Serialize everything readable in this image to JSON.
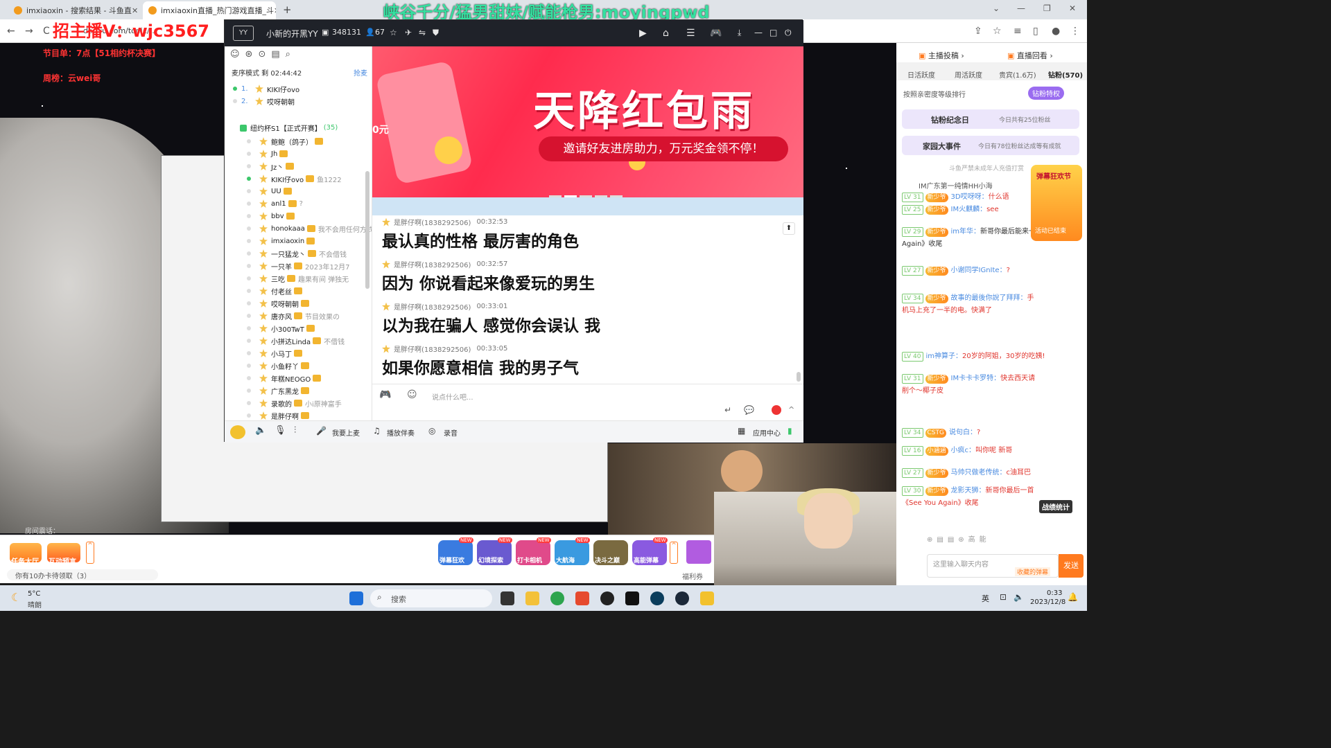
{
  "browser": {
    "tabs": [
      {
        "title": "imxiaoxin - 搜索结果 - 斗鱼直"
      },
      {
        "title": "imxiaoxin直播_热门游戏直播_斗"
      }
    ],
    "url": "douyu.com/topic/..."
  },
  "overlay": {
    "top_banner": "峡谷千分/猛男甜妹/赋能枪男:moyingpwd",
    "red_banner": "招主播V：wjc3567",
    "schedule": "节目单：7点【51相约杯决赛】",
    "weekly": "周榜：云wei哥"
  },
  "yy": {
    "title": "小新的开黑YY",
    "channel_id": "348131",
    "online_count": "67",
    "mode_label": "麦序模式 剩 02:44:42",
    "grab_mic": "抢麦",
    "queue": [
      {
        "rank": "1.",
        "name": "KIKI仔ovo"
      },
      {
        "rank": "2.",
        "name": "哎呀朝朝"
      }
    ],
    "group_title": "纽约杯S1【正式开赛】",
    "group_count": "(35)",
    "members": [
      {
        "name": "鲍鲍（鸽子）",
        "note": ""
      },
      {
        "name": "Jh",
        "note": ""
      },
      {
        "name": "Jz丶",
        "note": ""
      },
      {
        "name": "KIKI仔ovo",
        "note": "鱼1222"
      },
      {
        "name": "UU",
        "note": ""
      },
      {
        "name": "anl1",
        "note": "?"
      },
      {
        "name": "bbv",
        "note": ""
      },
      {
        "name": "honokaaa",
        "note": "我不会用任何方式"
      },
      {
        "name": "imxiaoxin",
        "note": ""
      },
      {
        "name": "一只猛龙丶",
        "note": "不会借钱"
      },
      {
        "name": "一只羊",
        "note": "2023年12月7"
      },
      {
        "name": "三吃",
        "note": "趣果有间 弹独无"
      },
      {
        "name": "付老丝",
        "note": ""
      },
      {
        "name": "哎呀朝朝",
        "note": ""
      },
      {
        "name": "唐亦风",
        "note": "节目效果の"
      },
      {
        "name": "小300TwT",
        "note": ""
      },
      {
        "name": "小拼达Linda",
        "note": "不借钱"
      },
      {
        "name": "小马丁",
        "note": ""
      },
      {
        "name": "小鱼籽丫",
        "note": ""
      },
      {
        "name": "年糕NEOGO",
        "note": ""
      },
      {
        "name": "广东黑龙",
        "note": ""
      },
      {
        "name": "录歌的",
        "note": "小i原神富手"
      },
      {
        "name": "是胖仔啊",
        "note": ""
      }
    ],
    "banner": {
      "title": "天降红包雨",
      "subtitle": "邀请好友进房助力，万元奖金领不停！",
      "coupon": "0元"
    },
    "messages": [
      {
        "sender": "是胖仔啊(1838292506)",
        "time": "00:32:53",
        "text": "最认真的性格 最厉害的角色"
      },
      {
        "sender": "是胖仔啊(1838292506)",
        "time": "00:32:57",
        "text": "因为 你说看起来像爱玩的男生"
      },
      {
        "sender": "是胖仔啊(1838292506)",
        "time": "00:33:01",
        "text": "以为我在骗人 感觉你会误认 我"
      },
      {
        "sender": "是胖仔啊(1838292506)",
        "time": "00:33:05",
        "text": "如果你愿意相信 我的男子气"
      }
    ],
    "input_placeholder": "说点什么吧...",
    "bottom": {
      "mic_up": "我要上麦",
      "play_music": "播放伴奏",
      "record": "录音",
      "app_center": "应用中心"
    }
  },
  "right_panel": {
    "top_links": [
      "主播投稿",
      "直播回看"
    ],
    "rank_tabs": [
      "日活跃度",
      "周活跃度",
      "贵宾(1.6万)",
      "钻粉(570)"
    ],
    "sort_label": "按照亲密度等级排行",
    "diamond_priv": "钻粉特权",
    "diamond_day": "钻粉纪念日",
    "diamond_day_info": "今日共有25位粉丝",
    "family_event": "家园大事件",
    "family_event_info": "今日有78位粉丝达成等有成就",
    "minor_notice": "斗鱼严禁未成年人充值打赏",
    "top_msg": "IM广东第一纯情HH小海",
    "chat": [
      {
        "lv": "LV 31",
        "fan": "新少爷",
        "nick": "3D哎呀呀：",
        "text": "什么语"
      },
      {
        "lv": "LV 25",
        "fan": "新少爷",
        "nick": "IM火麒麟：",
        "text": "see"
      },
      {
        "lv": "LV 29",
        "fan": "新少爷",
        "nick": "im年华：",
        "text": "新哥你最后能来一首《See You Again》收尾"
      },
      {
        "lv": "LV 27",
        "fan": "新少爷",
        "nick": "小谢同学IGnIte：",
        "text": "?"
      },
      {
        "lv": "LV 34",
        "fan": "新少爷",
        "nick": "故事的最後你說了拜拜：",
        "text": "手机马上充了一半的电。快满了"
      },
      {
        "lv": "LV 40",
        "fan": "",
        "nick": "im神算子：",
        "text": "20岁的阿姐，30岁的吃姨!"
      },
      {
        "lv": "LV 31",
        "fan": "新少爷",
        "nick": "IM卡卡卡罗特：",
        "text": "快去西天请削个～椰子皮"
      },
      {
        "lv": "LV 34",
        "fan": "CSTG",
        "nick": "说句白：",
        "text": "?"
      },
      {
        "lv": "LV 16",
        "fan": "小涵涵",
        "nick": "小疯c：",
        "text": "叫你呢 新哥"
      },
      {
        "lv": "LV 27",
        "fan": "新少爷",
        "nick": "马帅只做老传统：",
        "text": "c油耳巴"
      },
      {
        "lv": "LV 30",
        "fan": "新少爷",
        "nick": "龙影天狮：",
        "text": "新哥你最后一首《See You Again》收尾"
      }
    ],
    "festival": "弹幕狂欢节",
    "festival_status": "活动已结束",
    "chat_placeholder": "这里输入聊天内容",
    "collect_danmu": "收藏的弹幕",
    "send": "发送",
    "stats_btn": "战绩统计",
    "level_badge": "高能"
  },
  "bottom_bar": {
    "task_hall": "任务大厅",
    "interact_preview": "互动预言",
    "card_notice": "你有10办卡待领取（3）",
    "room_notice": "房间震话：",
    "welfare": "福利券",
    "gifts": [
      {
        "label": "弹幕狂欢",
        "tag": "NEW"
      },
      {
        "label": "幻境探索",
        "tag": "NEW"
      },
      {
        "label": "打卡相机",
        "tag": "NEW"
      },
      {
        "label": "大航海",
        "tag": "NEW"
      },
      {
        "label": "决斗之巅",
        "tag": ""
      },
      {
        "label": "高能弹幕",
        "tag": "NEW"
      }
    ]
  },
  "taskbar": {
    "weather_temp": "5°C",
    "weather_desc": "晴朗",
    "search": "搜索",
    "ime": "英",
    "time": "0:33",
    "date": "2023/12/8"
  },
  "colors": {
    "accent_red": "#ff2b4d",
    "douyu_orange": "#ff7a1f",
    "online_green": "#3cc76b",
    "banner_green": "#35e0a0"
  }
}
